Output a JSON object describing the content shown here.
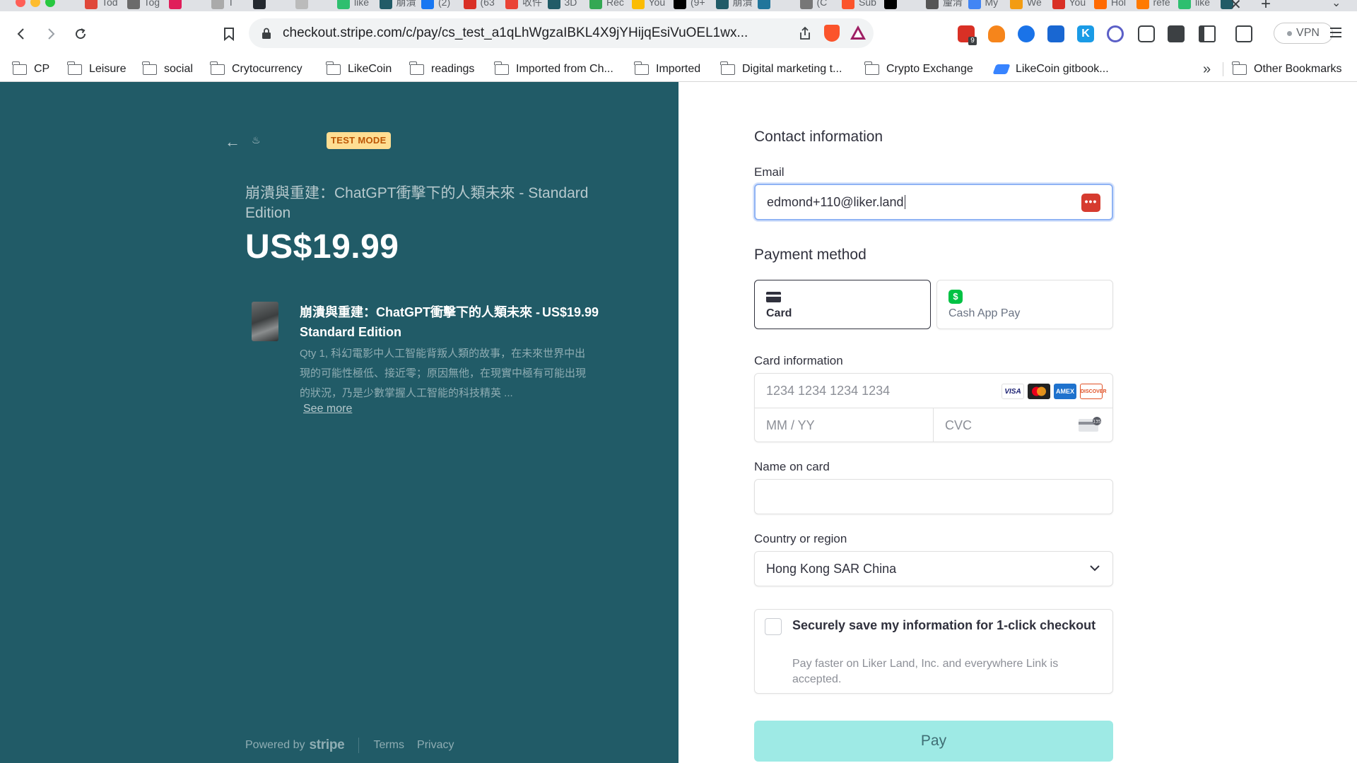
{
  "browser": {
    "tabs": [
      {
        "label": "Tod",
        "color": "#e0483a"
      },
      {
        "label": "Tog",
        "color": "#6b6b6b"
      },
      {
        "label": "",
        "color": "#e01e5a"
      },
      {
        "label": "T",
        "color": "#aaaaaa"
      },
      {
        "label": "",
        "color": "#24292f"
      },
      {
        "label": "",
        "color": "#bbbbbb"
      },
      {
        "label": "like",
        "color": "#2ebf6f"
      },
      {
        "label": "崩潰",
        "color": "#215b67"
      },
      {
        "label": "(2)",
        "color": "#1877f2"
      },
      {
        "label": "(63",
        "color": "#d93025"
      },
      {
        "label": "收件",
        "color": "#ea4335"
      },
      {
        "label": "3D",
        "color": "#215b67"
      },
      {
        "label": "Rec",
        "color": "#34a853"
      },
      {
        "label": "You",
        "color": "#fbbc04"
      },
      {
        "label": "(9+",
        "color": "#000000"
      },
      {
        "label": "崩潰",
        "color": "#215b67"
      },
      {
        "label": "",
        "color": "#21759b"
      },
      {
        "label": "(C",
        "color": "#777777"
      },
      {
        "label": "Sub",
        "color": "#fb542b"
      },
      {
        "label": "",
        "color": "#000000"
      },
      {
        "label": "釐清",
        "color": "#555555"
      },
      {
        "label": "My",
        "color": "#4285f4"
      },
      {
        "label": "We",
        "color": "#f39c12"
      },
      {
        "label": "You",
        "color": "#d93025"
      },
      {
        "label": "Hol",
        "color": "#ff6a00"
      },
      {
        "label": "refe",
        "color": "#ff7a00"
      },
      {
        "label": "like",
        "color": "#2ebf6f"
      },
      {
        "label": "",
        "color": "#215b67"
      }
    ],
    "url": "checkout.stripe.com/c/pay/cs_test_a1qLhWgzaIBKL4X9jYHijqEsiVuOEL1wx...",
    "extension_badge": "9",
    "vpn_label": "VPN",
    "bookmarks": [
      "CP",
      "Leisure",
      "social",
      "Crytocurrency",
      "LikeCoin",
      "readings",
      "Imported from Ch...",
      "Imported",
      "Digital marketing t...",
      "Crypto Exchange",
      "LikeCoin gitbook..."
    ],
    "bookmarks_overflow": "»",
    "other_bookmarks": "Other Bookmarks"
  },
  "summary": {
    "test_mode_badge": "TEST MODE",
    "product_title": "崩潰與重建：ChatGPT衝擊下的人類未來 - Standard Edition",
    "price": "US$19.99",
    "item": {
      "name": "崩潰與重建：ChatGPT衝擊下的人類未來 - Standard Edition",
      "price": "US$19.99",
      "description": "Qty 1, 科幻電影中人工智能背叛人類的故事，在未來世界中出現的可能性極低、接近零；原因無他，在現實中極有可能出現的狀況，乃是少數掌握人工智能的科技精英 ...",
      "see_more": "See more"
    },
    "footer": {
      "powered_by": "Powered by",
      "stripe": "stripe",
      "terms": "Terms",
      "privacy": "Privacy"
    }
  },
  "form": {
    "contact_heading": "Contact information",
    "email_label": "Email",
    "email_value": "edmond+110@liker.land",
    "payment_heading": "Payment method",
    "methods": {
      "card": "Card",
      "cashapp": "Cash App Pay"
    },
    "card_info_label": "Card information",
    "card_number_placeholder": "1234 1234 1234 1234",
    "expiry_placeholder": "MM / YY",
    "cvc_placeholder": "CVC",
    "brands": [
      "VISA",
      "mastercard",
      "AMEX",
      "DISCOVER"
    ],
    "name_label": "Name on card",
    "name_value": "",
    "country_label": "Country or region",
    "country_value": "Hong Kong SAR China",
    "save_title": "Securely save my information for 1-click checkout",
    "save_subtitle": "Pay faster on Liker Land, Inc. and everywhere Link is accepted.",
    "pay_button": "Pay"
  }
}
